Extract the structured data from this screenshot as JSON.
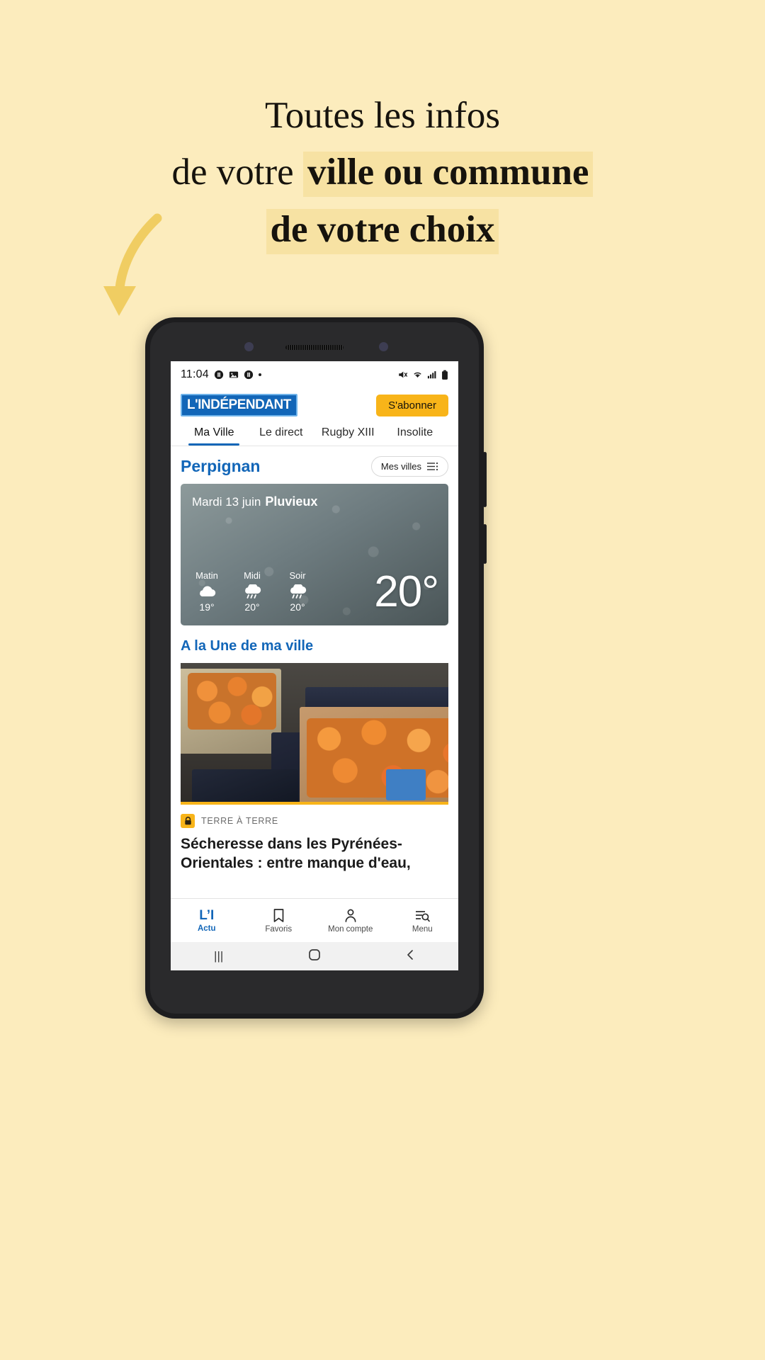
{
  "promo": {
    "line1": "Toutes les infos",
    "line2_plain": "de votre ",
    "line2_highlight": "ville ou commune",
    "line3_highlight": "de votre choix"
  },
  "status_bar": {
    "time": "11:04",
    "icons": [
      "pause-circle-icon",
      "image-icon",
      "pause-circle-icon",
      "dot-icon"
    ],
    "right_icons": [
      "mute-icon",
      "wifi-icon",
      "signal-icon",
      "battery-icon"
    ]
  },
  "app_header": {
    "logo_text": "L'INDÉPENDANT",
    "subscribe_label": "S'abonner"
  },
  "tabs": [
    {
      "label": "Ma Ville",
      "active": true
    },
    {
      "label": "Le direct",
      "active": false
    },
    {
      "label": "Rugby XIII",
      "active": false
    },
    {
      "label": "Insolite",
      "active": false
    }
  ],
  "city_row": {
    "city": "Perpignan",
    "my_cities_label": "Mes villes"
  },
  "weather": {
    "date": "Mardi 13 juin",
    "condition": "Pluvieux",
    "temperature": "20°",
    "slots": [
      {
        "label": "Matin",
        "icon": "cloud-icon",
        "value": "19°"
      },
      {
        "label": "Midi",
        "icon": "rain-cloud-icon",
        "value": "20°"
      },
      {
        "label": "Soir",
        "icon": "rain-cloud-icon",
        "value": "20°"
      }
    ]
  },
  "section": {
    "title": "A la Une de ma ville"
  },
  "article": {
    "kicker": "TERRE À TERRE",
    "title": "Sécheresse dans les Pyrénées-Orientales : entre manque d'eau,",
    "image_alt": "apricot-crates-photo",
    "badge": "lock-icon"
  },
  "bottom_nav": [
    {
      "label": "Actu",
      "icon": "brand-li-icon",
      "active": true
    },
    {
      "label": "Favoris",
      "icon": "bookmark-icon",
      "active": false
    },
    {
      "label": "Mon compte",
      "icon": "person-icon",
      "active": false
    },
    {
      "label": "Menu",
      "icon": "menu-search-icon",
      "active": false
    }
  ],
  "system_nav": {
    "recents": "|||",
    "home": "home-square-icon",
    "back": "back-chevron-icon"
  },
  "colors": {
    "page_bg": "#fcecbd",
    "highlight": "#f7e2a3",
    "brand_blue": "#1266b8",
    "accent_yellow": "#f8b419",
    "arrow": "#f0cd62"
  }
}
